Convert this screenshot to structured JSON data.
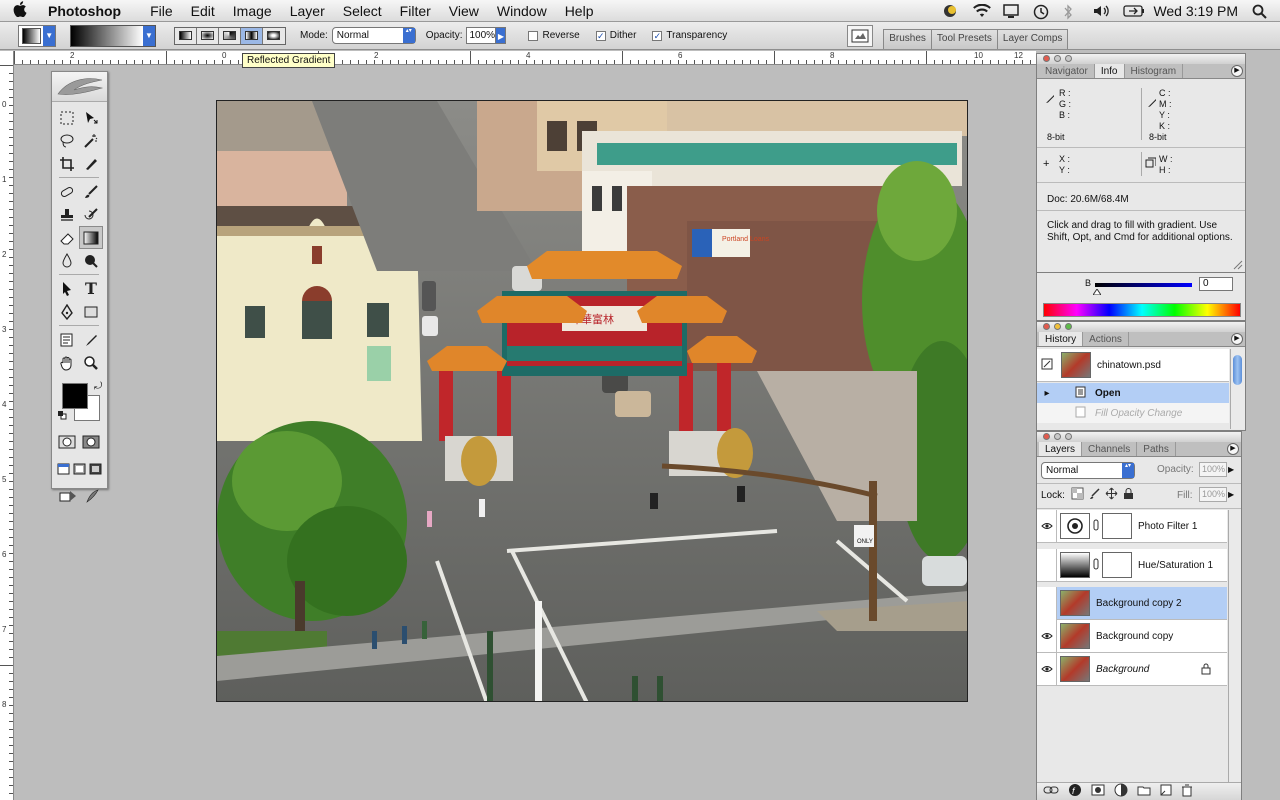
{
  "menubar": {
    "app_name": "Photoshop",
    "items": [
      "File",
      "Edit",
      "Image",
      "Layer",
      "Select",
      "Filter",
      "View",
      "Window",
      "Help"
    ],
    "clock": "Wed 3:19 PM"
  },
  "options": {
    "mode_label": "Mode:",
    "mode_value": "Normal",
    "opacity_label": "Opacity:",
    "opacity_value": "100%",
    "reverse_label": "Reverse",
    "dither_label": "Dither",
    "transparency_label": "Transparency",
    "reverse_checked": false,
    "dither_checked": true,
    "transparency_checked": true,
    "palette_tabs": [
      "Brushes",
      "Tool Presets",
      "Layer Comps"
    ]
  },
  "tooltip": "Reflected Gradient",
  "rulers": {
    "h_labels": [
      "2",
      "0",
      "2",
      "4",
      "6",
      "8",
      "10",
      "12"
    ],
    "v_labels": [
      "0",
      "1",
      "2",
      "3",
      "4",
      "5",
      "6",
      "7",
      "8"
    ]
  },
  "info": {
    "tabs": [
      "Navigator",
      "Info",
      "Histogram"
    ],
    "active_tab": "Info",
    "rgb_labels": [
      "R :",
      "G :",
      "B :"
    ],
    "cmyk_labels": [
      "C :",
      "M :",
      "Y :",
      "K :"
    ],
    "bitdepth_left": "8-bit",
    "bitdepth_right": "8-bit",
    "xy_labels": [
      "X :",
      "Y :"
    ],
    "wh_labels": [
      "W :",
      "H :"
    ],
    "doc_size": "Doc: 20.6M/68.4M",
    "hint": "Click and drag to fill with gradient.  Use Shift, Opt, and Cmd for additional options."
  },
  "color": {
    "channel_label": "B",
    "value": "0"
  },
  "history": {
    "tabs": [
      "History",
      "Actions"
    ],
    "snapshot_name": "chinatown.psd",
    "states": [
      "Open",
      "Fill Opacity Change"
    ]
  },
  "layers": {
    "tabs": [
      "Layers",
      "Channels",
      "Paths"
    ],
    "blend_mode": "Normal",
    "opacity_label": "Opacity:",
    "opacity_value": "100%",
    "lock_label": "Lock:",
    "fill_label": "Fill:",
    "fill_value": "100%",
    "items": [
      {
        "name": "Photo Filter 1",
        "visible": true,
        "selected": false
      },
      {
        "name": "Hue/Saturation 1",
        "visible": false,
        "selected": false
      },
      {
        "name": "Background copy 2",
        "visible": false,
        "selected": true
      },
      {
        "name": "Background copy",
        "visible": true,
        "selected": false
      },
      {
        "name": "Background",
        "visible": true,
        "selected": false
      }
    ]
  },
  "canvas": {
    "gate_sign": "埠華富林",
    "ad_sign": "Portland Loans",
    "street_sign": "ONLY"
  },
  "colors": {
    "accent": "#3a6fd1",
    "selection": "#b3cef5",
    "foreground": "#000000",
    "background": "#ffffff"
  }
}
